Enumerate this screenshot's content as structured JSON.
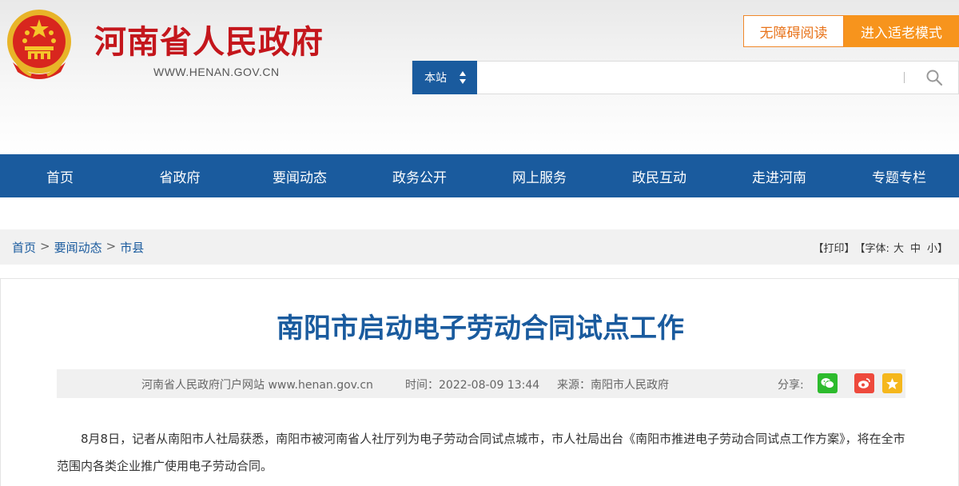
{
  "header": {
    "site_title": "河南省人民政府",
    "site_url": "WWW.HENAN.GOV.CN",
    "accessibility_label": "无障碍阅读",
    "elder_mode_label": "进入适老模式"
  },
  "search": {
    "scope": "本站",
    "placeholder": ""
  },
  "nav": {
    "items": [
      "首页",
      "省政府",
      "要闻动态",
      "政务公开",
      "网上服务",
      "政民互动",
      "走进河南",
      "专题专栏"
    ]
  },
  "breadcrumb": {
    "items": [
      "首页",
      "要闻动态",
      "市县"
    ],
    "separator": ">"
  },
  "tools": {
    "print": "【打印】",
    "font_prefix": "【字体:",
    "font_large": "大",
    "font_medium": "中",
    "font_small": "小",
    "font_suffix": "】"
  },
  "article": {
    "title": "南阳市启动电子劳动合同试点工作",
    "source_site": "河南省人民政府门户网站 www.henan.gov.cn",
    "time": "时间：2022-08-09 13:44",
    "origin": "来源：南阳市人民政府",
    "share_label": "分享:",
    "paragraph": "8月8日，记者从南阳市人社局获悉，南阳市被河南省人社厅列为电子劳动合同试点城市，市人社局出台《南阳市推进电子劳动合同试点工作方案》，将在全市范围内各类企业推广使用电子劳动合同。"
  },
  "colors": {
    "brand_red": "#c4161c",
    "nav_blue": "#1a5b9e",
    "orange": "#f7941d"
  },
  "icons": [
    "national-emblem-icon",
    "sort-arrows-icon",
    "search-icon",
    "wechat-icon",
    "weibo-icon",
    "favorite-star-icon"
  ]
}
